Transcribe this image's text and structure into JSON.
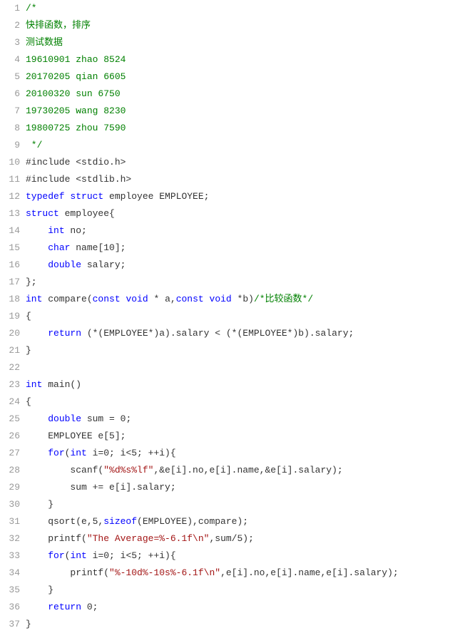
{
  "code": {
    "lines": [
      {
        "n": 1,
        "tokens": [
          {
            "c": "cm",
            "t": "/*"
          }
        ]
      },
      {
        "n": 2,
        "tokens": [
          {
            "c": "cm",
            "t": "快排函数，排序"
          }
        ]
      },
      {
        "n": 3,
        "tokens": [
          {
            "c": "cm",
            "t": "测试数据"
          }
        ]
      },
      {
        "n": 4,
        "tokens": [
          {
            "c": "cm",
            "t": "19610901 zhao 8524"
          }
        ]
      },
      {
        "n": 5,
        "tokens": [
          {
            "c": "cm",
            "t": "20170205 qian 6605"
          }
        ]
      },
      {
        "n": 6,
        "tokens": [
          {
            "c": "cm",
            "t": "20100320 sun 6750"
          }
        ]
      },
      {
        "n": 7,
        "tokens": [
          {
            "c": "cm",
            "t": "19730205 wang 8230"
          }
        ]
      },
      {
        "n": 8,
        "tokens": [
          {
            "c": "cm",
            "t": "19800725 zhou 7590"
          }
        ]
      },
      {
        "n": 9,
        "tokens": [
          {
            "c": "cm",
            "t": " */"
          }
        ]
      },
      {
        "n": 10,
        "tokens": [
          {
            "c": "pl",
            "t": "#include <stdio.h>"
          }
        ]
      },
      {
        "n": 11,
        "tokens": [
          {
            "c": "pl",
            "t": "#include <stdlib.h>"
          }
        ]
      },
      {
        "n": 12,
        "tokens": [
          {
            "c": "kw",
            "t": "typedef"
          },
          {
            "c": "pl",
            "t": " "
          },
          {
            "c": "kw",
            "t": "struct"
          },
          {
            "c": "pl",
            "t": " employee EMPLOYEE;"
          }
        ]
      },
      {
        "n": 13,
        "tokens": [
          {
            "c": "kw",
            "t": "struct"
          },
          {
            "c": "pl",
            "t": " employee{"
          }
        ]
      },
      {
        "n": 14,
        "tokens": [
          {
            "c": "pl",
            "t": "    "
          },
          {
            "c": "kw",
            "t": "int"
          },
          {
            "c": "pl",
            "t": " no;"
          }
        ]
      },
      {
        "n": 15,
        "tokens": [
          {
            "c": "pl",
            "t": "    "
          },
          {
            "c": "kw",
            "t": "char"
          },
          {
            "c": "pl",
            "t": " name[10];"
          }
        ]
      },
      {
        "n": 16,
        "tokens": [
          {
            "c": "pl",
            "t": "    "
          },
          {
            "c": "kw",
            "t": "double"
          },
          {
            "c": "pl",
            "t": " salary;"
          }
        ]
      },
      {
        "n": 17,
        "tokens": [
          {
            "c": "pl",
            "t": "};"
          }
        ]
      },
      {
        "n": 18,
        "tokens": [
          {
            "c": "kw",
            "t": "int"
          },
          {
            "c": "pl",
            "t": " compare("
          },
          {
            "c": "kw",
            "t": "const"
          },
          {
            "c": "pl",
            "t": " "
          },
          {
            "c": "kw",
            "t": "void"
          },
          {
            "c": "pl",
            "t": " * a,"
          },
          {
            "c": "kw",
            "t": "const"
          },
          {
            "c": "pl",
            "t": " "
          },
          {
            "c": "kw",
            "t": "void"
          },
          {
            "c": "pl",
            "t": " *b)"
          },
          {
            "c": "cm",
            "t": "/*比较函数*/"
          }
        ]
      },
      {
        "n": 19,
        "tokens": [
          {
            "c": "pl",
            "t": "{"
          }
        ]
      },
      {
        "n": 20,
        "tokens": [
          {
            "c": "pl",
            "t": "    "
          },
          {
            "c": "kw",
            "t": "return"
          },
          {
            "c": "pl",
            "t": " (*(EMPLOYEE*)a).salary < (*(EMPLOYEE*)b).salary;"
          }
        ]
      },
      {
        "n": 21,
        "tokens": [
          {
            "c": "pl",
            "t": "}"
          }
        ]
      },
      {
        "n": 22,
        "tokens": [
          {
            "c": "pl",
            "t": ""
          }
        ]
      },
      {
        "n": 23,
        "tokens": [
          {
            "c": "kw",
            "t": "int"
          },
          {
            "c": "pl",
            "t": " main()"
          }
        ]
      },
      {
        "n": 24,
        "tokens": [
          {
            "c": "pl",
            "t": "{"
          }
        ]
      },
      {
        "n": 25,
        "tokens": [
          {
            "c": "pl",
            "t": "    "
          },
          {
            "c": "kw",
            "t": "double"
          },
          {
            "c": "pl",
            "t": " sum = 0;"
          }
        ]
      },
      {
        "n": 26,
        "tokens": [
          {
            "c": "pl",
            "t": "    EMPLOYEE e[5];"
          }
        ]
      },
      {
        "n": 27,
        "tokens": [
          {
            "c": "pl",
            "t": "    "
          },
          {
            "c": "kw",
            "t": "for"
          },
          {
            "c": "pl",
            "t": "("
          },
          {
            "c": "kw",
            "t": "int"
          },
          {
            "c": "pl",
            "t": " i=0; i<5; ++i){"
          }
        ]
      },
      {
        "n": 28,
        "tokens": [
          {
            "c": "pl",
            "t": "        scanf("
          },
          {
            "c": "str",
            "t": "\"%d%s%lf\""
          },
          {
            "c": "pl",
            "t": ",&e[i].no,e[i].name,&e[i].salary);"
          }
        ]
      },
      {
        "n": 29,
        "tokens": [
          {
            "c": "pl",
            "t": "        sum += e[i].salary;"
          }
        ]
      },
      {
        "n": 30,
        "tokens": [
          {
            "c": "pl",
            "t": "    }"
          }
        ]
      },
      {
        "n": 31,
        "tokens": [
          {
            "c": "pl",
            "t": "    qsort(e,5,"
          },
          {
            "c": "kw",
            "t": "sizeof"
          },
          {
            "c": "pl",
            "t": "(EMPLOYEE),compare);"
          }
        ]
      },
      {
        "n": 32,
        "tokens": [
          {
            "c": "pl",
            "t": "    printf("
          },
          {
            "c": "str",
            "t": "\"The Average=%-6.1f\\n\""
          },
          {
            "c": "pl",
            "t": ",sum/5);"
          }
        ]
      },
      {
        "n": 33,
        "tokens": [
          {
            "c": "pl",
            "t": "    "
          },
          {
            "c": "kw",
            "t": "for"
          },
          {
            "c": "pl",
            "t": "("
          },
          {
            "c": "kw",
            "t": "int"
          },
          {
            "c": "pl",
            "t": " i=0; i<5; ++i){"
          }
        ]
      },
      {
        "n": 34,
        "tokens": [
          {
            "c": "pl",
            "t": "        printf("
          },
          {
            "c": "str",
            "t": "\"%-10d%-10s%-6.1f\\n\""
          },
          {
            "c": "pl",
            "t": ",e[i].no,e[i].name,e[i].salary);"
          }
        ]
      },
      {
        "n": 35,
        "tokens": [
          {
            "c": "pl",
            "t": "    }"
          }
        ]
      },
      {
        "n": 36,
        "tokens": [
          {
            "c": "pl",
            "t": "    "
          },
          {
            "c": "kw",
            "t": "return"
          },
          {
            "c": "pl",
            "t": " 0;"
          }
        ]
      },
      {
        "n": 37,
        "tokens": [
          {
            "c": "pl",
            "t": "}"
          }
        ]
      }
    ]
  }
}
